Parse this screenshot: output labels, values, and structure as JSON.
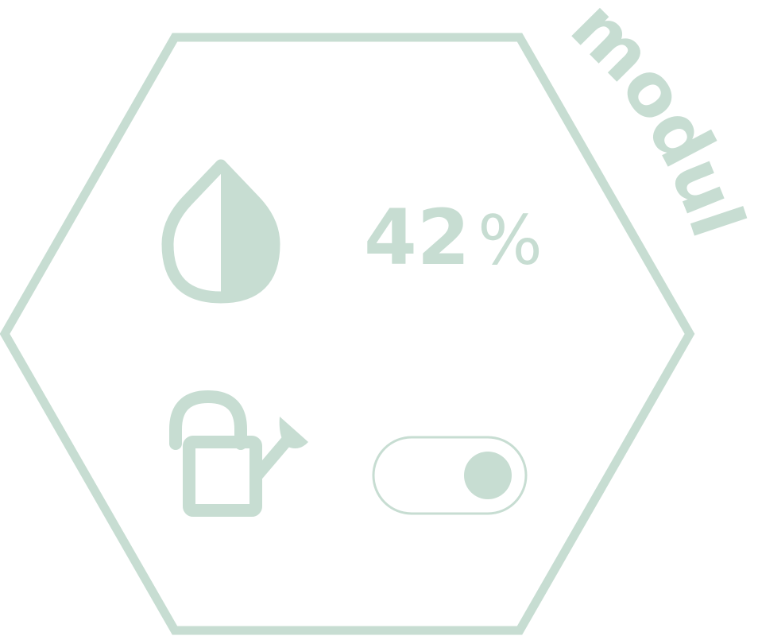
{
  "module": {
    "label": "module"
  },
  "humidity": {
    "value": 42,
    "display_number": "42",
    "display_unit": "%",
    "icon": "water-drop-half-icon"
  },
  "watering": {
    "icon": "watering-can-icon",
    "enabled": true
  },
  "colors": {
    "accent": "#c7ddd2",
    "background": "#ffffff"
  }
}
